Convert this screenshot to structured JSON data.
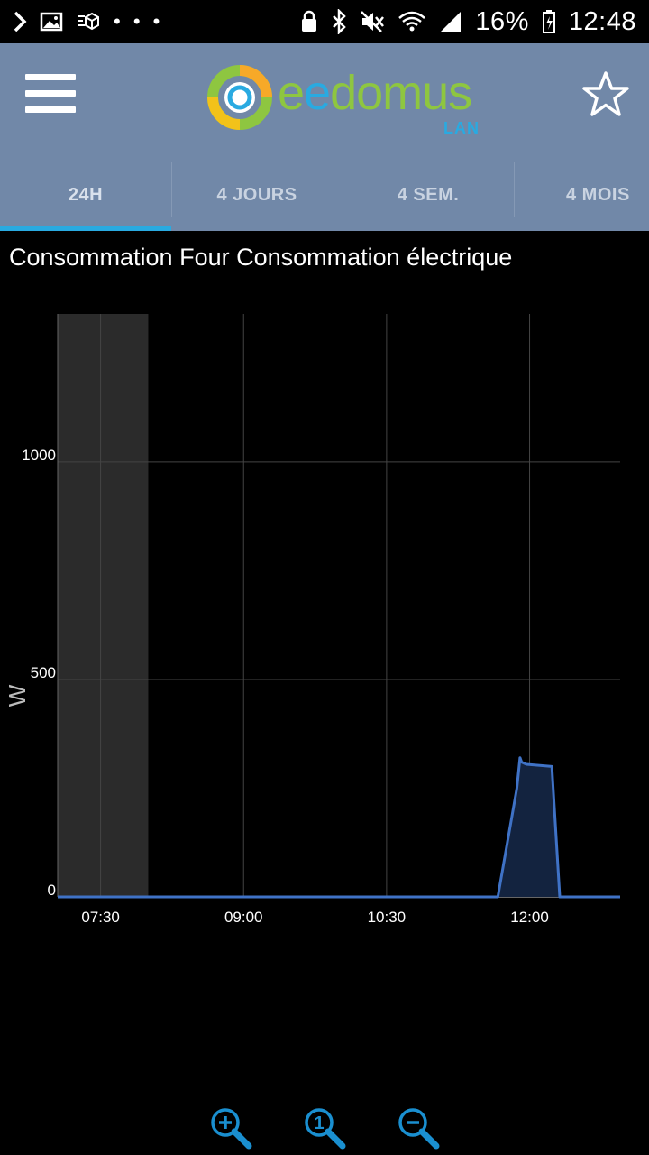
{
  "status_bar": {
    "battery_percent": "16%",
    "time": "12:48",
    "left_icons": [
      "chevron-icon",
      "image-icon",
      "cube-icon",
      "more-dots-icon"
    ],
    "right_icons": [
      "lock-icon",
      "bluetooth-icon",
      "mute-icon",
      "wifi-icon",
      "signal-icon",
      "battery-icon"
    ]
  },
  "header": {
    "logo_part1": "e",
    "logo_part2": "e",
    "logo_part3": "domus",
    "logo_sub": "LAN",
    "menu_icon": "hamburger-icon",
    "favorite_icon": "star-icon"
  },
  "tabs": [
    {
      "label": "24H",
      "selected": true
    },
    {
      "label": "4 JOURS",
      "selected": false
    },
    {
      "label": "4 SEM.",
      "selected": false
    },
    {
      "label": "4 MOIS",
      "selected": false
    }
  ],
  "colors": {
    "header_bg": "#7188a8",
    "accent": "#29aae1",
    "logo_green": "#8ec640",
    "series_line": "#3f72c6",
    "series_fill": "#13233f",
    "night_band": "#2b2b2b"
  },
  "chart_title": "Consommation Four Consommation électrique",
  "chart_data": {
    "type": "area",
    "title": "Consommation Four Consommation électrique",
    "ylabel": "W",
    "xlabel": "",
    "x_ticks": [
      "07:30",
      "09:00",
      "10:30",
      "12:00"
    ],
    "x_tick_values": [
      7.5,
      9.0,
      10.5,
      12.0
    ],
    "y_ticks": [
      0,
      500,
      1000
    ],
    "y_tick_labels": [
      "0",
      "500",
      "1000"
    ],
    "xlim": [
      "07:03",
      "12:57"
    ],
    "ylim": [
      0,
      1340
    ],
    "grid": true,
    "legend": "bottom-left",
    "night_band": [
      "07:03",
      "08:00"
    ],
    "series": [
      {
        "x": [
          "07:03",
          "11:40",
          "11:52",
          "11:54",
          "11:55",
          "11:58",
          "12:14",
          "12:19",
          "12:57"
        ],
        "y": [
          0,
          0,
          250,
          320,
          310,
          305,
          300,
          0,
          0
        ]
      }
    ]
  },
  "zoom_controls": {
    "zoom_in_icon": "zoom-in-icon",
    "zoom_reset_icon": "zoom-reset-icon",
    "zoom_out_icon": "zoom-out-icon",
    "reset_glyph": "1"
  }
}
